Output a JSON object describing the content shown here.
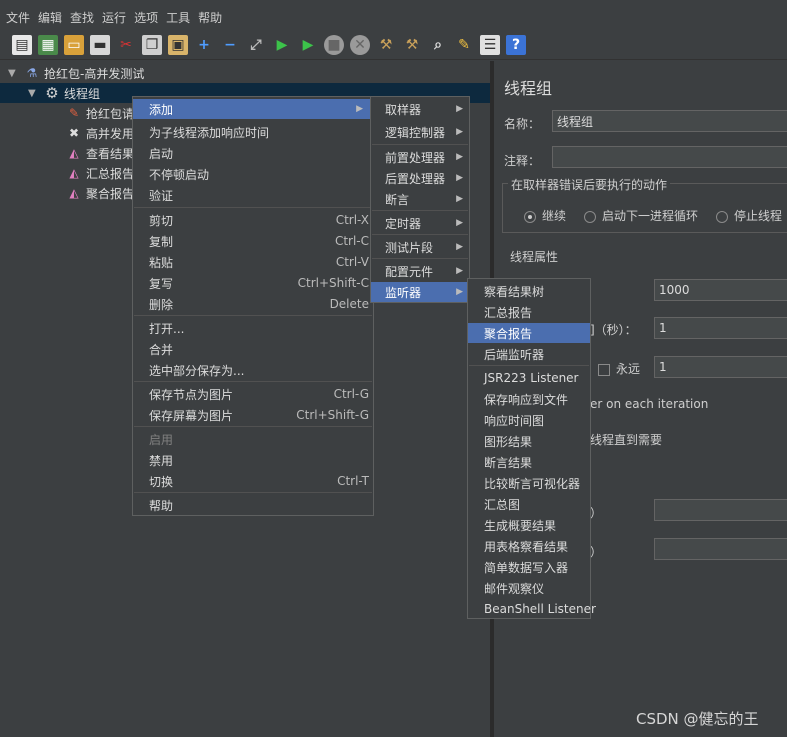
{
  "menubar": [
    "文件",
    "编辑",
    "查找",
    "运行",
    "选项",
    "工具",
    "帮助"
  ],
  "toolbar_icons": [
    "new-icon",
    "templates-icon",
    "open-icon",
    "save-icon",
    "cut-icon",
    "copy-icon",
    "paste-icon",
    "expand-icon",
    "collapse-icon",
    "toggle-icon",
    "start-icon",
    "start-no-pause-icon",
    "stop-icon",
    "shutdown-icon",
    "clear-icon",
    "clear-all-icon",
    "search-icon",
    "reset-search-icon",
    "function-helper-icon",
    "help-icon"
  ],
  "tree": {
    "root": "抢红包-高并发测试",
    "thread_group": "线程组",
    "children": [
      "抢红包请",
      "高并发用",
      "查看结果",
      "汇总报告",
      "聚合报告"
    ]
  },
  "context_menu": [
    {
      "label": "添加",
      "shortcut": "",
      "sub": true,
      "highlight": true
    },
    {
      "label": "为子线程添加响应时间",
      "shortcut": "",
      "sub": false
    },
    {
      "label": "启动",
      "shortcut": "",
      "sub": false
    },
    {
      "label": "不停顿启动",
      "shortcut": "",
      "sub": false
    },
    {
      "label": "验证",
      "shortcut": "",
      "sub": false
    },
    {
      "label": "剪切",
      "shortcut": "Ctrl-X",
      "sub": false
    },
    {
      "label": "复制",
      "shortcut": "Ctrl-C",
      "sub": false
    },
    {
      "label": "粘贴",
      "shortcut": "Ctrl-V",
      "sub": false
    },
    {
      "label": "复写",
      "shortcut": "Ctrl+Shift-C",
      "sub": false
    },
    {
      "label": "删除",
      "shortcut": "Delete",
      "sub": false
    },
    {
      "label": "打开...",
      "shortcut": "",
      "sub": false
    },
    {
      "label": "合并",
      "shortcut": "",
      "sub": false
    },
    {
      "label": "选中部分保存为...",
      "shortcut": "",
      "sub": false
    },
    {
      "label": "保存节点为图片",
      "shortcut": "Ctrl-G",
      "sub": false
    },
    {
      "label": "保存屏幕为图片",
      "shortcut": "Ctrl+Shift-G",
      "sub": false
    },
    {
      "label": "启用",
      "shortcut": "",
      "sub": false,
      "disabled": true
    },
    {
      "label": "禁用",
      "shortcut": "",
      "sub": false
    },
    {
      "label": "切换",
      "shortcut": "Ctrl-T",
      "sub": false
    },
    {
      "label": "帮助",
      "shortcut": "",
      "sub": false
    }
  ],
  "add_submenu": [
    {
      "label": "取样器"
    },
    {
      "label": "逻辑控制器"
    },
    {
      "label": "前置处理器"
    },
    {
      "label": "后置处理器"
    },
    {
      "label": "断言"
    },
    {
      "label": "定时器"
    },
    {
      "label": "测试片段"
    },
    {
      "label": "配置元件"
    },
    {
      "label": "监听器",
      "highlight": true
    }
  ],
  "listener_submenu": [
    "察看结果树",
    "汇总报告",
    "聚合报告",
    "后端监听器",
    "JSR223 Listener",
    "保存响应到文件",
    "响应时间图",
    "图形结果",
    "断言结果",
    "比较断言可视化器",
    "汇总图",
    "生成概要结果",
    "用表格察看结果",
    "简单数据写入器",
    "邮件观察仪",
    "BeanShell Listener"
  ],
  "listener_highlight_index": 2,
  "right_panel": {
    "title": "线程组",
    "name_label": "名称：",
    "name_value": "线程组",
    "comment_label": "注释：",
    "error_group_label": "在取样器错误后要执行的动作",
    "radio_continue": "继续",
    "radio_next_loop": "启动下一进程循环",
    "radio_stop_thread": "停止线程",
    "thread_props_label": "线程属性",
    "threads_value": "1000",
    "rampup_label_tail": "]（秒）：",
    "rampup_value": "1",
    "forever_label": "永远",
    "loop_value": "1",
    "same_user_tail": "er on each iteration",
    "delay_tail": "线程直到需要",
    "dur_tail": "）",
    "delay2_tail": "）"
  },
  "watermark": "CSDN @健忘的王"
}
